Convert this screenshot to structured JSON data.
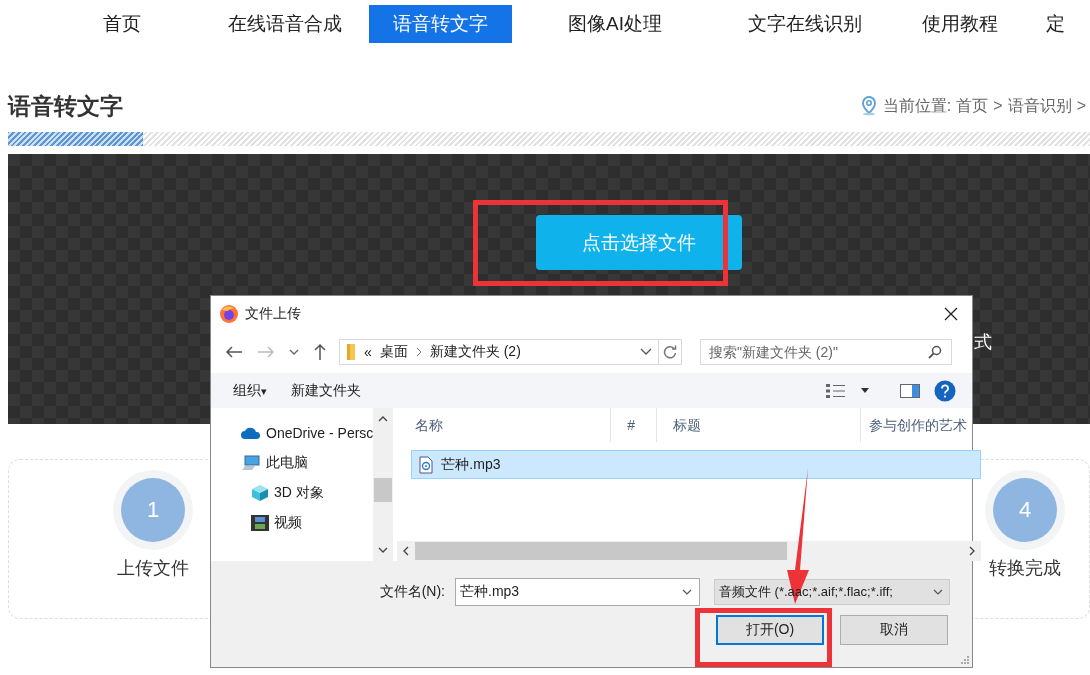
{
  "nav": {
    "items": [
      {
        "label": "首页",
        "selected": false
      },
      {
        "label": "在线语音合成",
        "selected": false
      },
      {
        "label": "语音转文字",
        "selected": true
      },
      {
        "label": "图像AI处理",
        "selected": false
      },
      {
        "label": "文字在线识别",
        "selected": false
      },
      {
        "label": "使用教程",
        "selected": false
      },
      {
        "label": "定",
        "selected": false
      }
    ]
  },
  "page_title": "语音转文字",
  "breadcrumb": {
    "label": "当前位置:",
    "separator": ">",
    "items": [
      "首页",
      "语音识别"
    ]
  },
  "upload": {
    "button": "点击选择文件",
    "text_right": "式"
  },
  "steps": [
    {
      "number": "1",
      "label": "上传文件"
    },
    {
      "number": "4",
      "label": "转换完成"
    }
  ],
  "dialog": {
    "title": "文件上传",
    "address_prefix": "«",
    "address": [
      "桌面",
      "新建文件夹 (2)"
    ],
    "search": {
      "placeholder": "搜索\"新建文件夹 (2)\""
    },
    "toolbar": [
      {
        "label": "组织",
        "caret": "▾"
      },
      {
        "label": "新建文件夹"
      }
    ],
    "nav_pane": [
      {
        "kind": "cloud",
        "label": "OneDrive - Persc"
      },
      {
        "kind": "pc",
        "label": "此电脑"
      },
      {
        "kind": "cube",
        "label": "3D 对象"
      },
      {
        "kind": "video",
        "label": "视频"
      }
    ],
    "columns": [
      "名称",
      "#",
      "标题",
      "参与创作的艺术"
    ],
    "files": [
      {
        "name": "芒种.mp3",
        "selected": true
      }
    ],
    "file_name": {
      "label": "文件名(N):",
      "value": "芒种.mp3"
    },
    "filter": "音频文件 (*.aac;*.aif;*.flac;*.iff;",
    "buttons": [
      {
        "label": "打开(O)",
        "default": true
      },
      {
        "label": "取消",
        "default": false
      }
    ]
  }
}
